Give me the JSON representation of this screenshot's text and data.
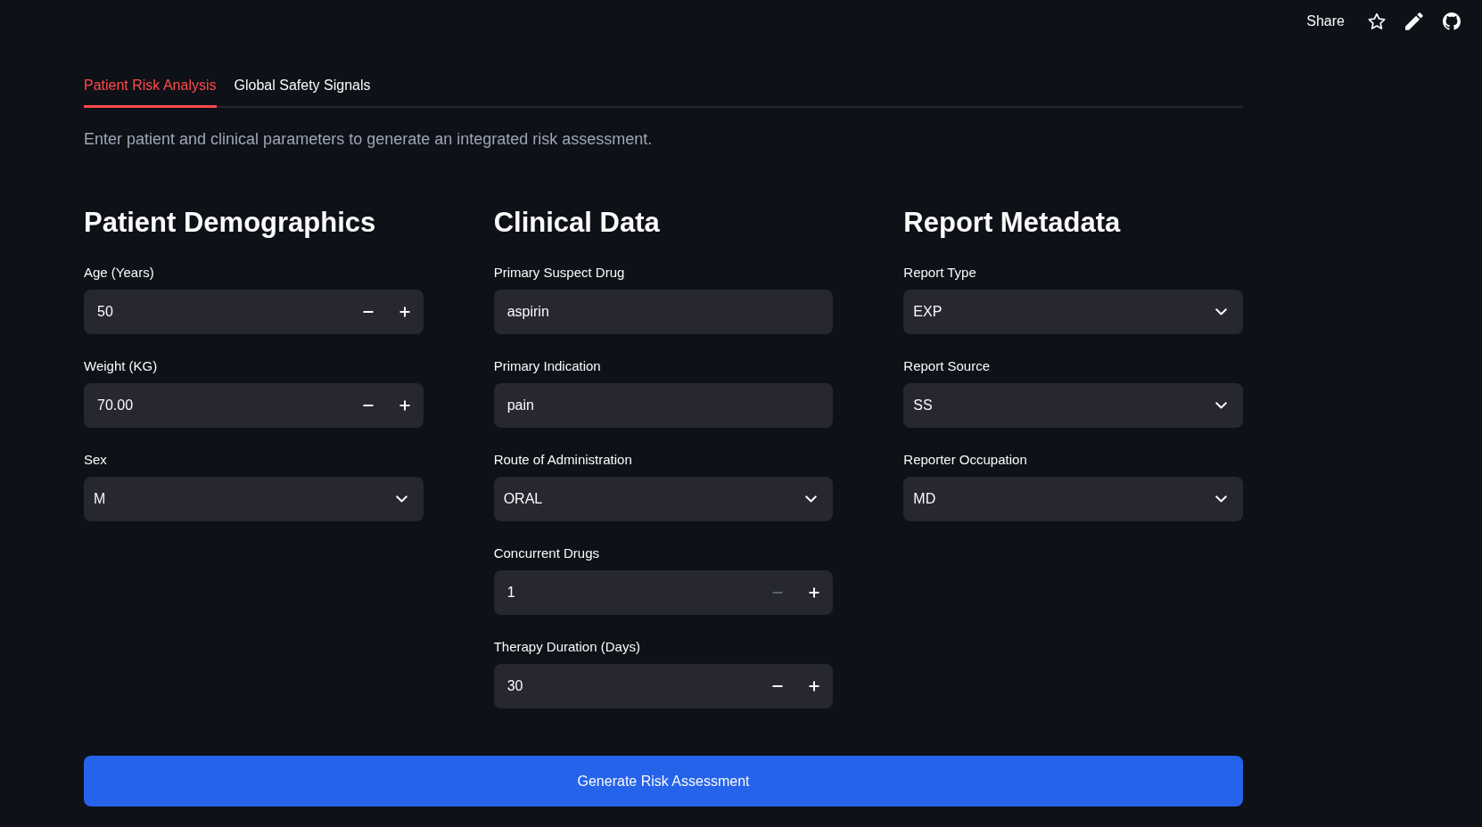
{
  "toolbar": {
    "share": "Share"
  },
  "tabs": [
    {
      "label": "Patient Risk Analysis",
      "selected": true
    },
    {
      "label": "Global Safety Signals",
      "selected": false
    }
  ],
  "intro": "Enter patient and clinical parameters to generate an integrated risk assessment.",
  "sections": [
    {
      "heading": "Patient Demographics",
      "fields": [
        {
          "kind": "number",
          "label": "Age (Years)",
          "value": "50",
          "decrement_disabled": false
        },
        {
          "kind": "number",
          "label": "Weight (KG)",
          "value": "70.00",
          "decrement_disabled": false
        },
        {
          "kind": "select",
          "label": "Sex",
          "value": "M"
        }
      ]
    },
    {
      "heading": "Clinical Data",
      "fields": [
        {
          "kind": "text",
          "label": "Primary Suspect Drug",
          "value": "aspirin"
        },
        {
          "kind": "text",
          "label": "Primary Indication",
          "value": "pain"
        },
        {
          "kind": "select",
          "label": "Route of Administration",
          "value": "ORAL"
        },
        {
          "kind": "number",
          "label": "Concurrent Drugs",
          "value": "1",
          "decrement_disabled": true
        },
        {
          "kind": "number",
          "label": "Therapy Duration (Days)",
          "value": "30",
          "decrement_disabled": false
        }
      ]
    },
    {
      "heading": "Report Metadata",
      "fields": [
        {
          "kind": "select",
          "label": "Report Type",
          "value": "EXP"
        },
        {
          "kind": "select",
          "label": "Report Source",
          "value": "SS"
        },
        {
          "kind": "select",
          "label": "Reporter Occupation",
          "value": "MD"
        }
      ]
    }
  ],
  "submit_button": {
    "label": "Generate Risk Assessment"
  }
}
